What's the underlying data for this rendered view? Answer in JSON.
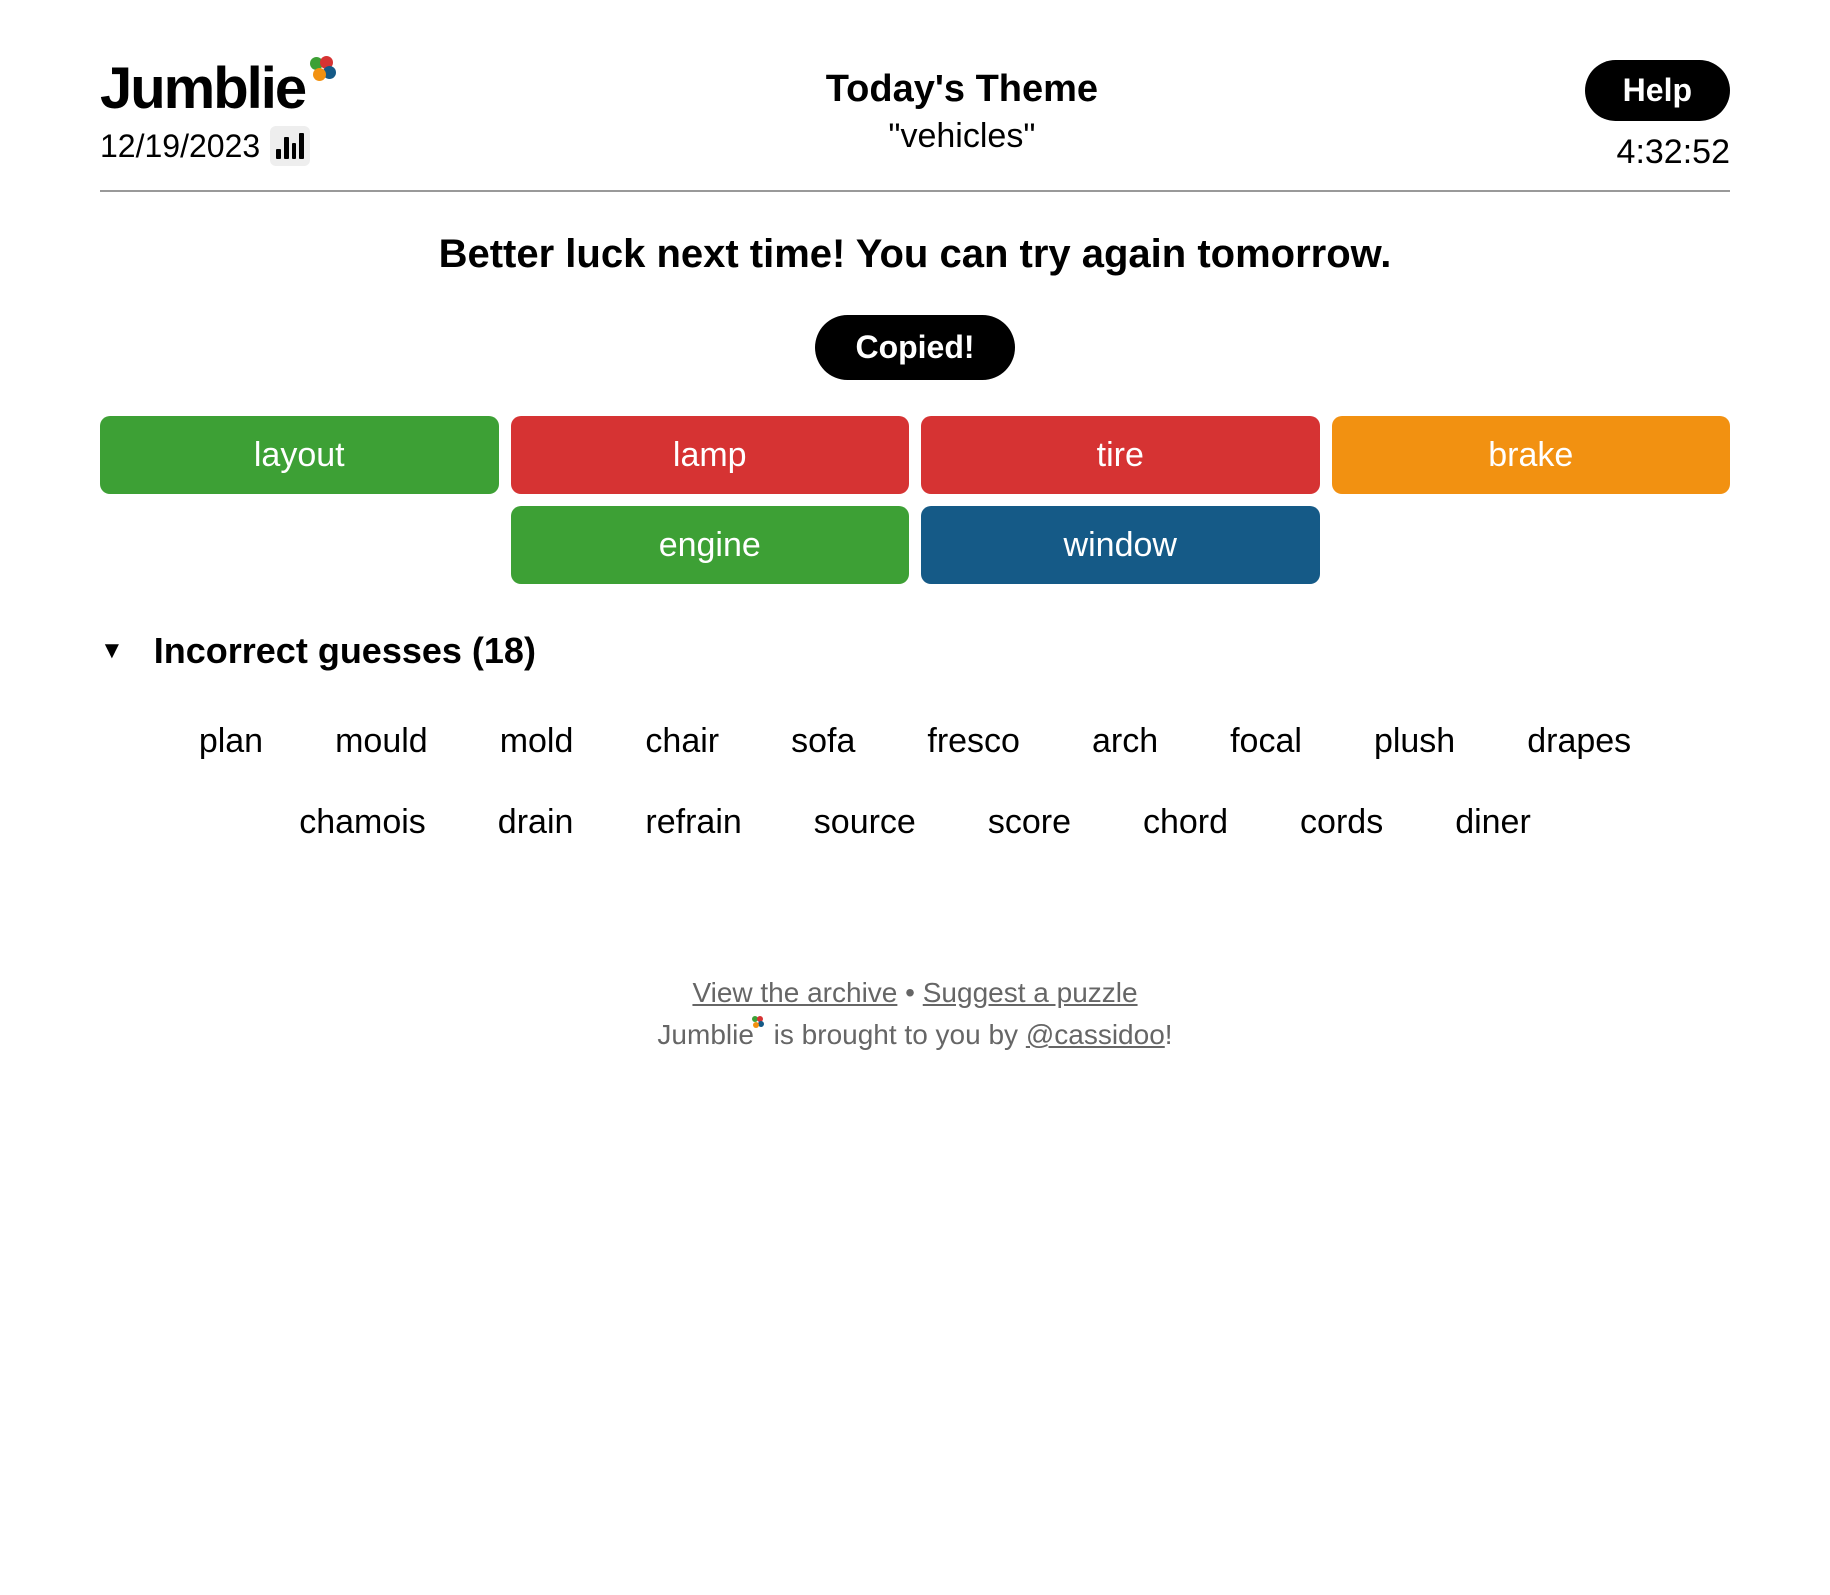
{
  "header": {
    "logo": "Jumblie",
    "date": "12/19/2023",
    "theme_label": "Today's Theme",
    "theme_value": "\"vehicles\"",
    "help_label": "Help",
    "timer": "4:32:52"
  },
  "message": "Better luck next time! You can try again tomorrow.",
  "share_label": "Copied!",
  "answers": [
    {
      "word": "layout",
      "color": "green"
    },
    {
      "word": "lamp",
      "color": "red"
    },
    {
      "word": "tire",
      "color": "red"
    },
    {
      "word": "brake",
      "color": "orange"
    },
    {
      "word": "engine",
      "color": "green"
    },
    {
      "word": "window",
      "color": "blue"
    }
  ],
  "incorrect": {
    "count": 18,
    "title_prefix": "Incorrect guesses",
    "words": [
      "plan",
      "mould",
      "mold",
      "chair",
      "sofa",
      "fresco",
      "arch",
      "focal",
      "plush",
      "drapes",
      "chamois",
      "drain",
      "refrain",
      "source",
      "score",
      "chord",
      "cords",
      "diner"
    ]
  },
  "footer": {
    "archive": "View the archive",
    "separator": " • ",
    "suggest": "Suggest a puzzle",
    "credit_prefix": "Jumblie",
    "credit_mid": " is brought to you by ",
    "credit_handle": "@cassidoo",
    "credit_suffix": "!"
  }
}
